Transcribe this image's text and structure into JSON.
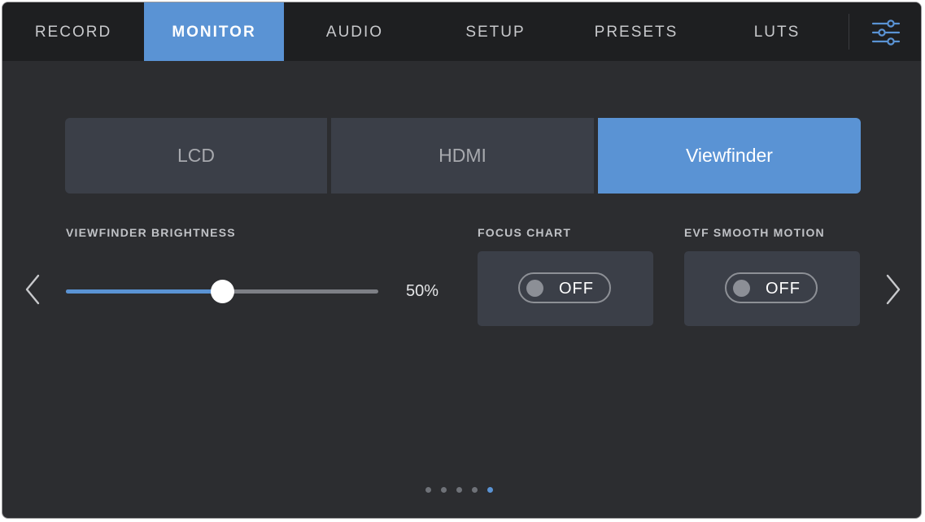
{
  "tabs": [
    {
      "label": "RECORD",
      "active": false
    },
    {
      "label": "MONITOR",
      "active": true
    },
    {
      "label": "AUDIO",
      "active": false
    },
    {
      "label": "SETUP",
      "active": false
    },
    {
      "label": "PRESETS",
      "active": false
    },
    {
      "label": "LUTS",
      "active": false
    }
  ],
  "menu_icon": "sliders-icon",
  "outputs": {
    "lcd": "LCD",
    "hdmi": "HDMI",
    "viewfinder": "Viewfinder",
    "selected": "Viewfinder"
  },
  "brightness": {
    "label": "VIEWFINDER BRIGHTNESS",
    "value_text": "50%",
    "level": 0.5
  },
  "focus_chart": {
    "label": "FOCUS CHART",
    "state": "OFF"
  },
  "evf_smooth_motion": {
    "label": "EVF SMOOTH MOTION",
    "state": "OFF"
  },
  "pagination": {
    "total": 5,
    "current": 5
  },
  "colors": {
    "accent": "#5a93d4",
    "background": "#2c2d30",
    "topbar": "#1e1f21",
    "card": "#3b3f48"
  }
}
